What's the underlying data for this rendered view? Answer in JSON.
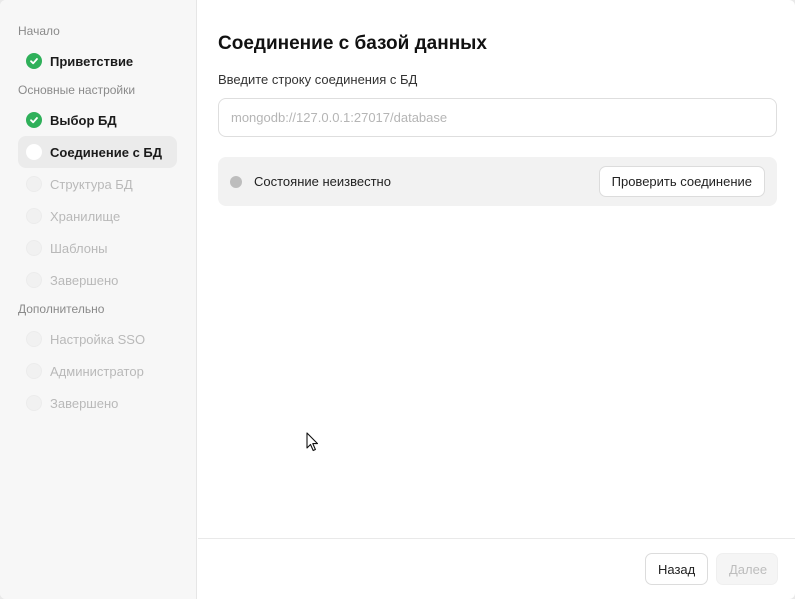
{
  "sidebar": {
    "sections": [
      {
        "title": "Начало"
      },
      {
        "title": "Основные настройки"
      },
      {
        "title": "Дополнительно"
      }
    ],
    "steps": [
      {
        "label": "Приветствие",
        "status": "done"
      },
      {
        "label": "Выбор БД",
        "status": "done"
      },
      {
        "label": "Соединение с БД",
        "status": "current"
      },
      {
        "label": "Структура БД",
        "status": "pending"
      },
      {
        "label": "Хранилище",
        "status": "pending"
      },
      {
        "label": "Шаблоны",
        "status": "pending"
      },
      {
        "label": "Завершено",
        "status": "pending"
      },
      {
        "label": "Настройка SSO",
        "status": "pending"
      },
      {
        "label": "Администратор",
        "status": "pending"
      },
      {
        "label": "Завершено",
        "status": "pending"
      }
    ]
  },
  "main": {
    "title": "Соединение с базой данных",
    "field_label": "Введите строку соединения с БД",
    "input_value": "",
    "input_placeholder": "mongodb://127.0.0.1:27017/database",
    "status_text": "Состояние неизвестно",
    "check_button": "Проверить соединение"
  },
  "footer": {
    "back_label": "Назад",
    "next_label": "Далее"
  },
  "colors": {
    "done": "#2fb05a",
    "status_unknown": "#bdbdbd"
  }
}
